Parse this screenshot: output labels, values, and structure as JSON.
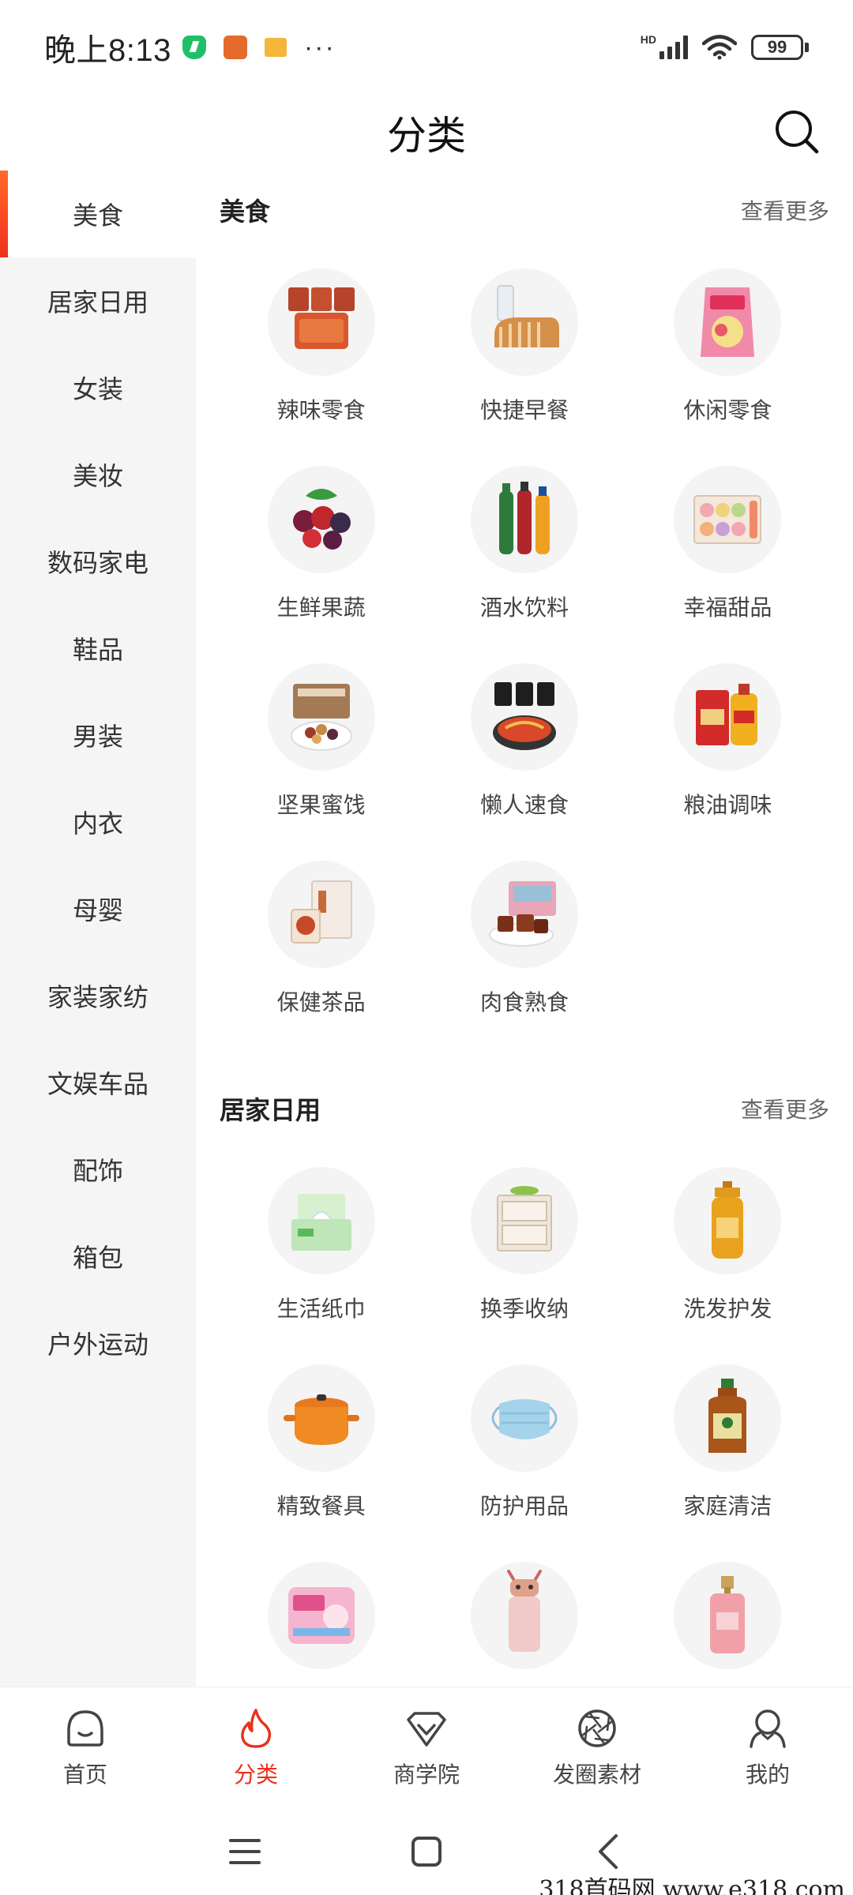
{
  "status_bar": {
    "time": "晚上8:13",
    "hd": "HD",
    "battery": "99",
    "more": "···"
  },
  "header": {
    "title": "分类"
  },
  "sidebar": {
    "items": [
      {
        "label": "美食"
      },
      {
        "label": "居家日用"
      },
      {
        "label": "女装"
      },
      {
        "label": "美妆"
      },
      {
        "label": "数码家电"
      },
      {
        "label": "鞋品"
      },
      {
        "label": "男装"
      },
      {
        "label": "内衣"
      },
      {
        "label": "母婴"
      },
      {
        "label": "家装家纺"
      },
      {
        "label": "文娱车品"
      },
      {
        "label": "配饰"
      },
      {
        "label": "箱包"
      },
      {
        "label": "户外运动"
      }
    ],
    "active_index": 0
  },
  "sections": [
    {
      "title": "美食",
      "more": "查看更多",
      "items": [
        {
          "label": "辣味零食",
          "icon": "spicy-snack-icon"
        },
        {
          "label": "快捷早餐",
          "icon": "bread-icon"
        },
        {
          "label": "休闲零食",
          "icon": "snack-bag-icon"
        },
        {
          "label": "生鲜果蔬",
          "icon": "berries-icon"
        },
        {
          "label": "酒水饮料",
          "icon": "bottles-icon"
        },
        {
          "label": "幸福甜品",
          "icon": "macaron-icon"
        },
        {
          "label": "坚果蜜饯",
          "icon": "nuts-icon"
        },
        {
          "label": "懒人速食",
          "icon": "instant-noodle-icon"
        },
        {
          "label": "粮油调味",
          "icon": "rice-oil-icon"
        },
        {
          "label": "保健茶品",
          "icon": "tea-icon"
        },
        {
          "label": "肉食熟食",
          "icon": "meat-icon"
        }
      ]
    },
    {
      "title": "居家日用",
      "more": "查看更多",
      "items": [
        {
          "label": "生活纸巾",
          "icon": "tissue-icon"
        },
        {
          "label": "换季收纳",
          "icon": "storage-box-icon"
        },
        {
          "label": "洗发护发",
          "icon": "shampoo-icon"
        },
        {
          "label": "精致餐具",
          "icon": "pot-icon"
        },
        {
          "label": "防护用品",
          "icon": "mask-icon"
        },
        {
          "label": "家庭清洁",
          "icon": "disinfectant-icon"
        },
        {
          "label": "",
          "icon": "sanitary-pad-icon"
        },
        {
          "label": "",
          "icon": "water-bottle-icon"
        },
        {
          "label": "",
          "icon": "perfume-icon"
        }
      ]
    }
  ],
  "bottom_nav": [
    {
      "label": "首页",
      "icon": "home-icon"
    },
    {
      "label": "分类",
      "icon": "flame-icon"
    },
    {
      "label": "商学院",
      "icon": "diamond-icon"
    },
    {
      "label": "发圈素材",
      "icon": "aperture-icon"
    },
    {
      "label": "我的",
      "icon": "profile-icon"
    }
  ],
  "active_nav": 1,
  "colors": {
    "accent": "#e8321e",
    "sidebar_bg": "#f5f5f5",
    "thumb_bg": "#f4f4f4"
  },
  "watermark": "318首码网  www.e318.com"
}
